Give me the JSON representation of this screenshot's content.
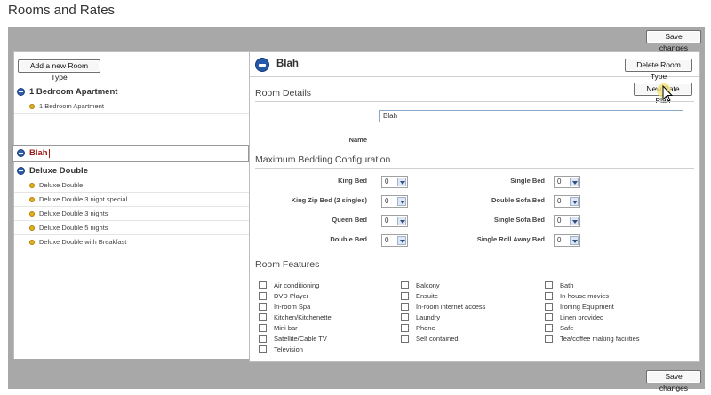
{
  "page_title": "Rooms and Rates",
  "save_label": "Save changes",
  "left": {
    "add_label": "Add a new Room Type",
    "groups": [
      {
        "name": "1 Bedroom Apartment",
        "items": [
          "1 Bedroom Apartment"
        ]
      },
      {
        "name": "Deluxe Double",
        "items": [
          "Deluxe Double",
          "Deluxe Double 3 night special",
          "Deluxe Double 3 nights",
          "Deluxe Double 5 nights",
          "Deluxe Double with Breakfast"
        ]
      }
    ],
    "selected": "Blah"
  },
  "right": {
    "room_name": "Blah",
    "delete_label": "Delete Room Type",
    "room_details_title": "Room Details",
    "new_plan_label": "New Rate Plan",
    "name_label": "Name",
    "name_value": "Blah",
    "bedding_title": "Maximum Bedding Configuration",
    "bedding": {
      "left": [
        {
          "label": "King Bed",
          "value": "0"
        },
        {
          "label": "King Zip Bed (2 singles)",
          "value": "0"
        },
        {
          "label": "Queen Bed",
          "value": "0"
        },
        {
          "label": "Double Bed",
          "value": "0"
        }
      ],
      "right": [
        {
          "label": "Single Bed",
          "value": "0"
        },
        {
          "label": "Double Sofa Bed",
          "value": "0"
        },
        {
          "label": "Single Sofa Bed",
          "value": "0"
        },
        {
          "label": "Single Roll Away Bed",
          "value": "0"
        }
      ]
    },
    "features_title": "Room Features",
    "features": {
      "col1": [
        "Air conditioning",
        "DVD Player",
        "In-room Spa",
        "Kitchen/Kitchenette",
        "Mini bar",
        "Satellite/Cable TV",
        "Television"
      ],
      "col2": [
        "Balcony",
        "Ensuite",
        "In-room internet access",
        "Laundry",
        "Phone",
        "Self contained"
      ],
      "col3": [
        "Bath",
        "In-house movies",
        "Ironing Equipment",
        "Linen provided",
        "Safe",
        "Tea/coffee making facilities"
      ]
    }
  },
  "colors": {
    "background": "#a8a8a8",
    "accent": "#2b5fb0",
    "selected_text": "#a21a1a"
  }
}
